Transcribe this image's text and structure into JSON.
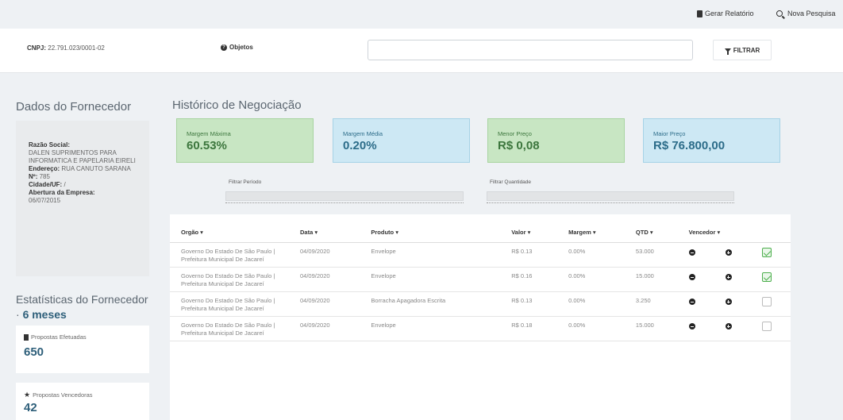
{
  "topbar": {
    "gerar_relatorio": "Gerar Relatório",
    "nova_pesquisa": "Nova Pesquisa"
  },
  "filter": {
    "cnpj_label": "CNPJ:",
    "cnpj_value": "22.791.023/0001-02",
    "objetos_label": "Objetos",
    "search_value": "",
    "filtrar_label": "FILTRAR"
  },
  "fornecedor": {
    "section_title": "Dados do Fornecedor",
    "razao_label": "Razão Social:",
    "razao_value": "DALEN SUPRIMENTOS PARA INFORMATICA E PAPELARIA EIRELI",
    "endereco_label": "Endereço:",
    "endereco_value": "RUA CANUTO SARANA",
    "numero_label": "Nº:",
    "numero_value": "785",
    "cidade_label": "Cidade/UF:",
    "cidade_value": "/",
    "abertura_label": "Abertura da Empresa:",
    "abertura_value": "06/07/2015"
  },
  "estatisticas": {
    "title": "Estatísticas do Fornecedor",
    "period": "6 meses",
    "propostas_efetuadas_label": "Propostas Efetuadas",
    "propostas_efetuadas_value": "650",
    "propostas_vencedoras_label": "Propostas Vencedoras",
    "propostas_vencedoras_value": "42"
  },
  "historico": {
    "title": "Histórico de Negociação",
    "metrics": [
      {
        "label": "Margem Máxima",
        "value": "60.53%",
        "color": "#c8e6c3"
      },
      {
        "label": "Margem Média",
        "value": "0.20%",
        "color": "#cde8f4"
      },
      {
        "label": "Menor Preço",
        "value": "R$ 0,08",
        "color": "#c8e6c3"
      },
      {
        "label": "Maior Preço",
        "value": "R$ 76.800,00",
        "color": "#cde8f4"
      }
    ],
    "filtrar_periodo": "Filtrar Período",
    "filtrar_quantidade": "Filtrar Quantidade"
  },
  "table": {
    "headers": [
      "Orgão ▾",
      "Data ▾",
      "Produto ▾",
      "Valor ▾",
      "Margem ▾",
      "QTD ▾",
      "Vencedor ▾"
    ],
    "rows": [
      {
        "orgao": "Governo Do Estado De São Paulo | Prefeitura Municipal De Jacareí",
        "data": "04/09/2020",
        "produto": "Envelope",
        "valor": "R$ 0.13",
        "margem": "0.00%",
        "qtd": "53.000",
        "checked": true
      },
      {
        "orgao": "Governo Do Estado De São Paulo | Prefeitura Municipal De Jacareí",
        "data": "04/09/2020",
        "produto": "Envelope",
        "valor": "R$ 0.16",
        "margem": "0.00%",
        "qtd": "15.000",
        "checked": true
      },
      {
        "orgao": "Governo Do Estado De São Paulo | Prefeitura Municipal De Jacareí",
        "data": "04/09/2020",
        "produto": "Borracha Apagadora Escrita",
        "valor": "R$ 0.13",
        "margem": "0.00%",
        "qtd": "3.250",
        "checked": false
      },
      {
        "orgao": "Governo Do Estado De São Paulo | Prefeitura Municipal De Jacareí",
        "data": "04/09/2020",
        "produto": "Envelope",
        "valor": "R$ 0.18",
        "margem": "0.00%",
        "qtd": "15.000",
        "checked": false
      }
    ]
  }
}
